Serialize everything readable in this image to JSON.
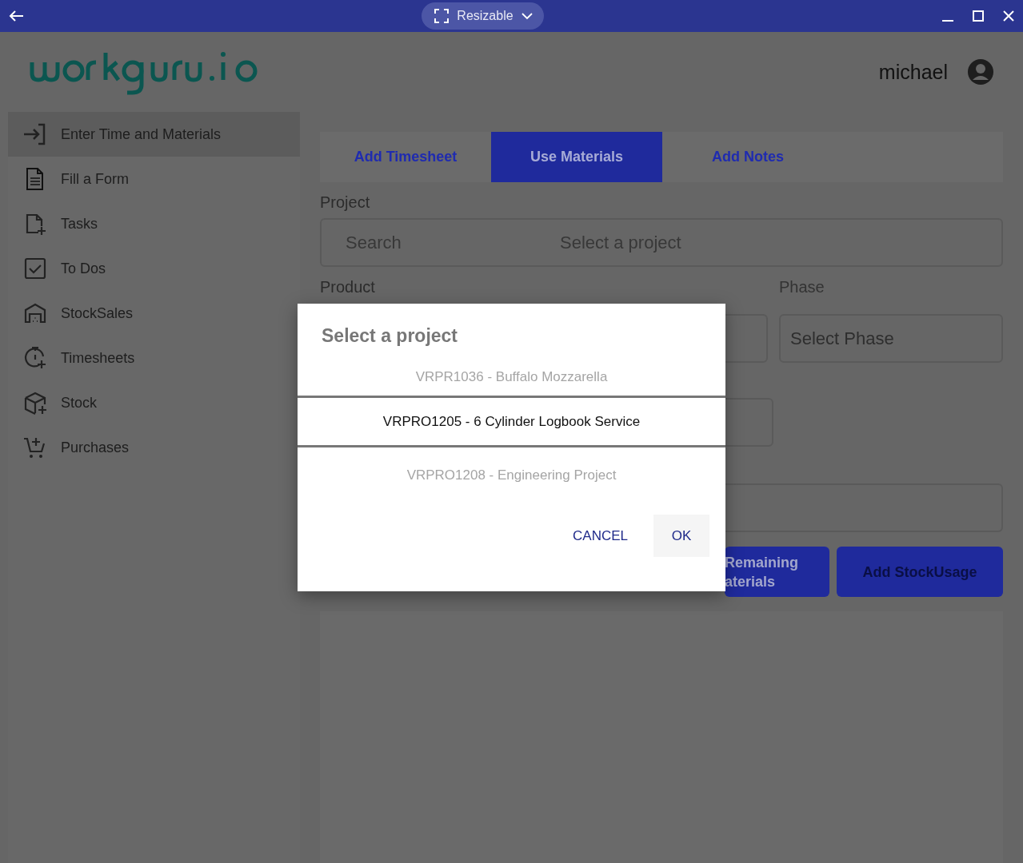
{
  "window": {
    "mode_label": "Resizable"
  },
  "header": {
    "user": "michael"
  },
  "sidebar": {
    "items": [
      {
        "label": "Enter Time and Materials",
        "selected": true
      },
      {
        "label": "Fill a Form",
        "selected": false
      },
      {
        "label": "Tasks",
        "selected": false
      },
      {
        "label": "To Dos",
        "selected": false
      },
      {
        "label": "StockSales",
        "selected": false
      },
      {
        "label": "Timesheets",
        "selected": false
      },
      {
        "label": "Stock",
        "selected": false
      },
      {
        "label": "Purchases",
        "selected": false
      }
    ]
  },
  "tabs": [
    {
      "label": "Add Timesheet",
      "selected": false
    },
    {
      "label": "Use Materials",
      "selected": true
    },
    {
      "label": "Add Notes",
      "selected": false
    }
  ],
  "form": {
    "project_label": "Project",
    "project_search": "Search",
    "project_placeholder": "Select a project",
    "product_label": "Product",
    "phase_label": "Phase",
    "phase_placeholder": "Select Phase",
    "buttons": [
      {
        "lines": [
          "Remaining",
          "aterials"
        ],
        "disabled": false
      },
      {
        "lines": [
          "Add StockUsage"
        ],
        "disabled": true
      }
    ]
  },
  "dialog": {
    "title": "Select a project",
    "items": [
      {
        "label": "VRPR1036 - Buffalo Mozzarella",
        "selected": false
      },
      {
        "label": "VRPRO1205 - 6 Cylinder Logbook Service",
        "selected": true
      },
      {
        "label": "VRPRO1208 - Engineering Project",
        "selected": false
      }
    ],
    "cancel": "CANCEL",
    "ok": "OK"
  }
}
